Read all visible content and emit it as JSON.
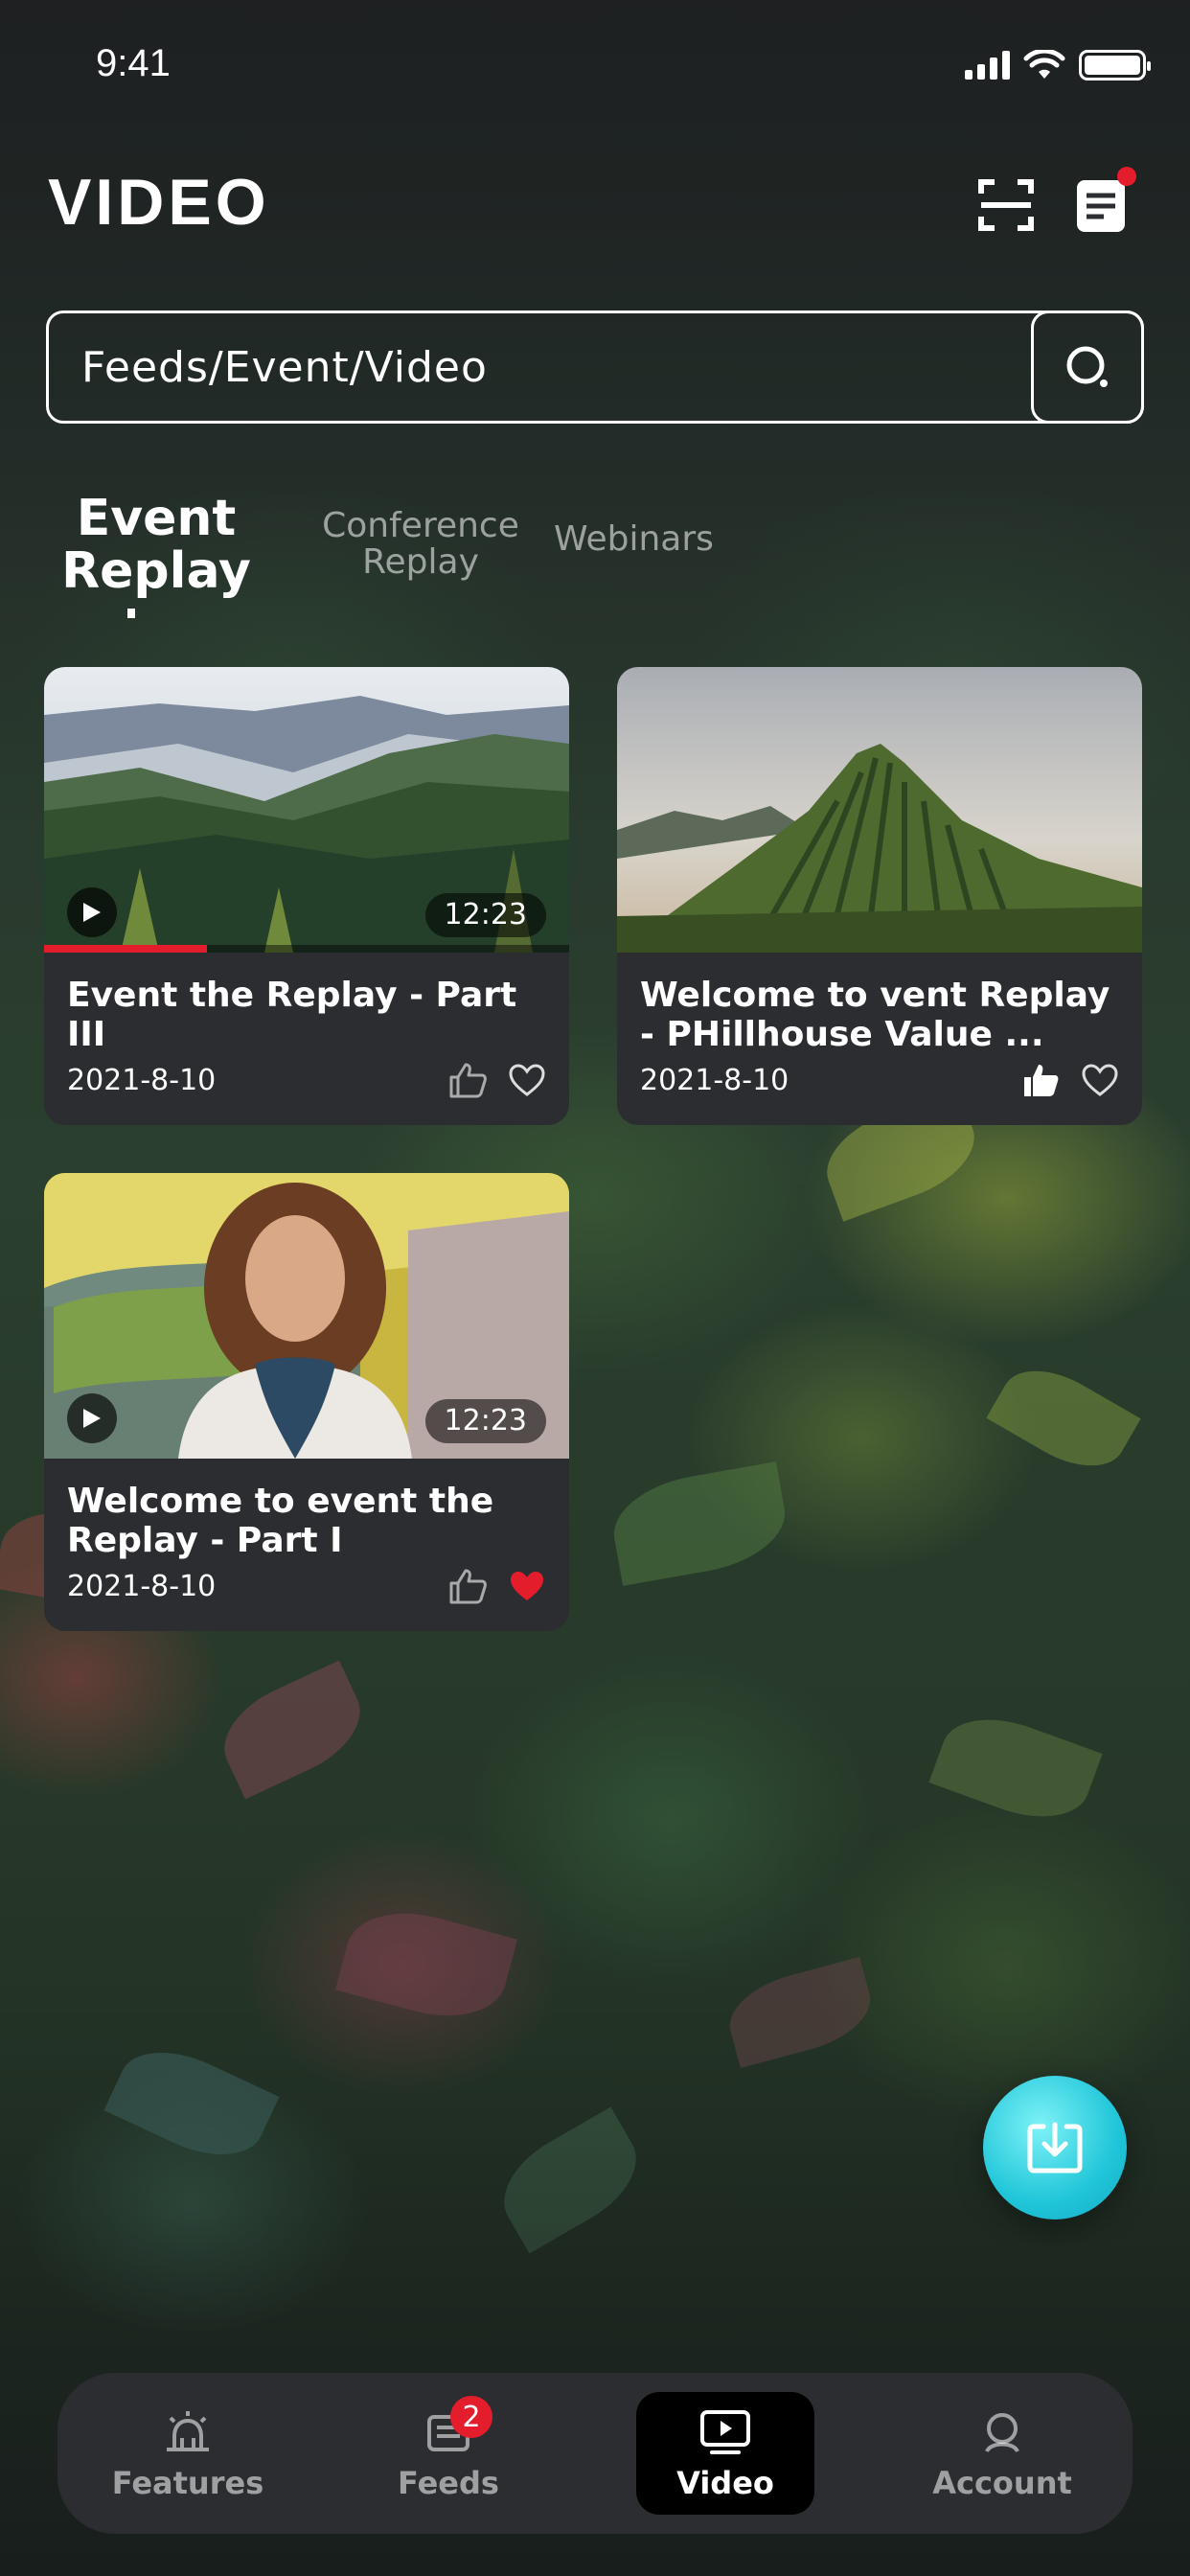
{
  "status_bar": {
    "time": "9:41"
  },
  "header": {
    "title": "VIDEO"
  },
  "search": {
    "value": "Feeds/Event/Video"
  },
  "tabs": [
    {
      "label": "Event Replay",
      "active": true
    },
    {
      "label": "Conference Replay",
      "active": false
    },
    {
      "label": "Webinars",
      "active": false
    }
  ],
  "videos": [
    {
      "title": "Event the Replay - Part III",
      "date": "2021-8-10",
      "duration": "12:23",
      "progress": 0.31,
      "liked": false,
      "favorited": false
    },
    {
      "title": "Welcome to vent Replay - PHillhouse Value ...",
      "date": "2021-8-10",
      "duration": "",
      "progress": 0,
      "liked": true,
      "favorited": false
    },
    {
      "title": "Welcome to event the Replay - Part I",
      "date": "2021-8-10",
      "duration": "12:23",
      "progress": 0,
      "liked": false,
      "favorited": true
    }
  ],
  "bottom_nav": [
    {
      "label": "Features",
      "icon": "alarm-light-icon",
      "badge": ""
    },
    {
      "label": "Feeds",
      "icon": "feeds-icon",
      "badge": "2"
    },
    {
      "label": "Video",
      "icon": "video-play-icon",
      "badge": "",
      "active": true
    },
    {
      "label": "Account",
      "icon": "account-icon",
      "badge": ""
    }
  ],
  "colors": {
    "accent": "#e31d2c",
    "fab": "#20c6d9",
    "card": "#2b2d31"
  }
}
